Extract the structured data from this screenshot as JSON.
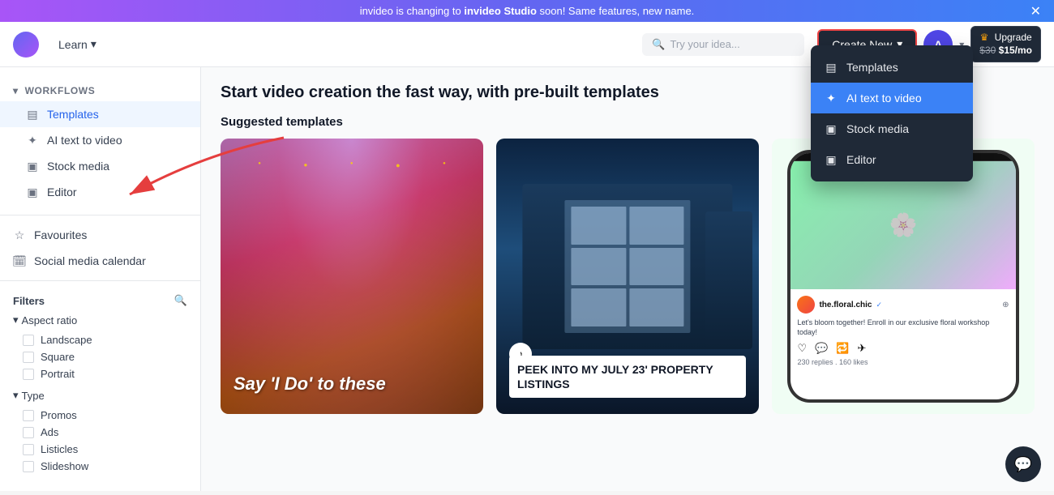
{
  "banner": {
    "text_before": "invideo is changing to ",
    "brand_name": "invideo Studio",
    "text_after": " soon! Same features, new name."
  },
  "header": {
    "learn_label": "Learn",
    "search_placeholder": "Try your idea...",
    "create_new_label": "Create New",
    "avatar_letter": "A",
    "upgrade_label": "Upgrade",
    "old_price": "$30",
    "new_price": "$15/mo"
  },
  "sidebar": {
    "workflows_label": "Workflows",
    "items": [
      {
        "label": "Templates",
        "icon": "▤",
        "active": true
      },
      {
        "label": "AI text to video",
        "icon": "✦"
      },
      {
        "label": "Stock media",
        "icon": "▣"
      },
      {
        "label": "Editor",
        "icon": "▣"
      }
    ],
    "other_items": [
      {
        "label": "Favourites",
        "icon": "☆"
      },
      {
        "label": "Social media calendar",
        "icon": "📅"
      }
    ]
  },
  "filters": {
    "title": "Filters",
    "aspect_ratio_label": "Aspect ratio",
    "aspect_options": [
      "Landscape",
      "Square",
      "Portrait"
    ],
    "type_label": "Type",
    "type_options": [
      "Promos",
      "Ads",
      "Listicles",
      "Slideshow"
    ]
  },
  "main": {
    "title": "Start video creation the fast way, with pre-built templates",
    "suggested_label": "Suggested templates",
    "templates": [
      {
        "title": "Say 'I Do' to these",
        "style": "wedding"
      },
      {
        "title": "PEEK INTO MY JULY 23' PROPERTY LISTINGS",
        "style": "property"
      },
      {
        "title": "floral workshop",
        "style": "social"
      }
    ]
  },
  "dropdown": {
    "items": [
      {
        "label": "Templates",
        "icon": "▤",
        "active": false
      },
      {
        "label": "AI text to video",
        "icon": "✦",
        "active": true
      },
      {
        "label": "Stock media",
        "icon": "▣",
        "active": false
      },
      {
        "label": "Editor",
        "icon": "▣",
        "active": false
      }
    ]
  },
  "card3": {
    "username": "the.floral.chic",
    "caption": "Let's bloom together! Enroll in our exclusive floral workshop today!",
    "stats": "230 replies . 160 likes"
  },
  "chat_icon": "💬"
}
